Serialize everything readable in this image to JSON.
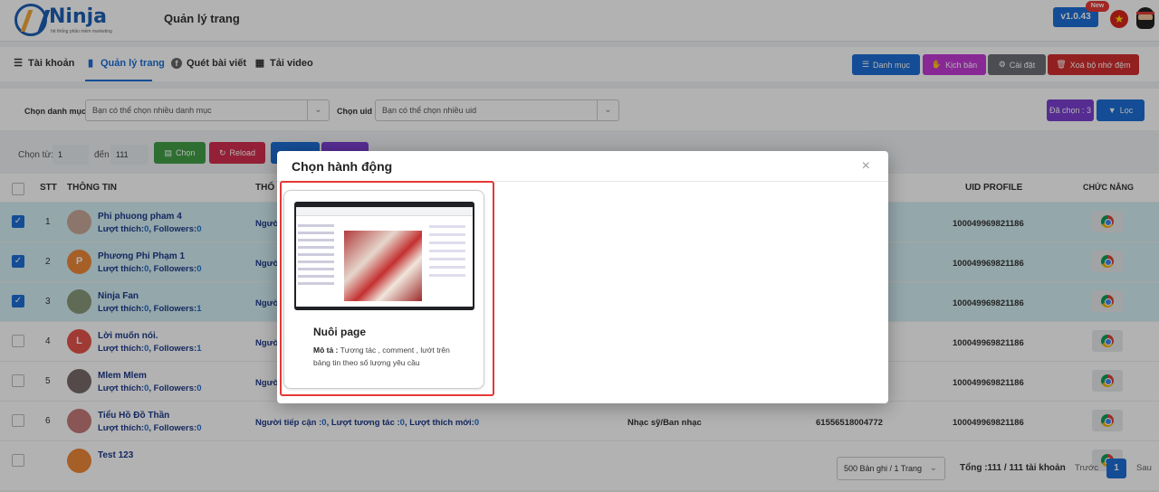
{
  "header": {
    "logo_text": "Ninja",
    "logo_tagline": "hệ thống phần mềm marketing",
    "page_title": "Quản lý trang",
    "version": "v1.0.43",
    "new_badge": "New"
  },
  "tabs": [
    {
      "label": "Tài khoản",
      "icon": "list-icon"
    },
    {
      "label": "Quản lý trang",
      "icon": "page-icon"
    },
    {
      "label": "Quét bài viết",
      "icon": "facebook-icon"
    },
    {
      "label": "Tải video",
      "icon": "video-icon"
    }
  ],
  "toolbar": {
    "category_button": "Danh mục",
    "script_button": "Kịch bản",
    "settings_button": "Cài đặt",
    "clear_cache_button": "Xoá bộ nhớ đệm",
    "colors": {
      "category": "#1d6fd6",
      "script": "#c33ad6",
      "settings": "#6c6f78",
      "clear_cache": "#d32f2f"
    }
  },
  "filters": {
    "category_label": "Chọn danh mục :",
    "category_placeholder": "Bạn có thể chọn nhiều danh mục",
    "uid_label": "Chọn uid :",
    "uid_placeholder": "Bạn có thể chọn nhiều uid",
    "selected_count": "Đã chọn : 3",
    "filter_button": "Lọc"
  },
  "range": {
    "from_label": "Chọn từ:",
    "from_value": "1",
    "to_label": "đến",
    "to_value": "111",
    "select_button": "Chọn",
    "reload_button": "Reload"
  },
  "table": {
    "headers": {
      "stt": "STT",
      "info": "THÔNG TIN",
      "interact": "THỐ",
      "uid_profile": "UID PROFILE",
      "function": "CHỨC NĂNG"
    },
    "rows": [
      {
        "stt": "1",
        "name": "Phi phuong pham 4",
        "likes": "0",
        "followers": "0",
        "avatar_letter": "",
        "avatar_color": "#c9a99a",
        "checked": true,
        "uid": "100049969821186",
        "interact": "Người",
        "reach": "",
        "interactions": "",
        "new_likes": "",
        "category": "",
        "page_id": ""
      },
      {
        "stt": "2",
        "name": "Phương Phi Phạm 1",
        "likes": "0",
        "followers": "0",
        "avatar_letter": "P",
        "avatar_color": "#f0883a",
        "checked": true,
        "uid": "100049969821186",
        "interact": "Người",
        "reach": "",
        "interactions": "",
        "new_likes": "",
        "category": "",
        "page_id": ""
      },
      {
        "stt": "3",
        "name": "Ninja Fan",
        "likes": "0",
        "followers": "1",
        "avatar_letter": "",
        "avatar_color": "#8a9a7a",
        "checked": true,
        "uid": "100049969821186",
        "interact": "Người",
        "reach": "",
        "interactions": "",
        "new_likes": "",
        "category": "",
        "page_id": ""
      },
      {
        "stt": "4",
        "name": "Lời muốn nói.",
        "likes": "0",
        "followers": "1",
        "avatar_letter": "L",
        "avatar_color": "#e5534b",
        "checked": false,
        "uid": "100049969821186",
        "interact": "Người",
        "reach": "",
        "interactions": "",
        "new_likes": "",
        "category": "",
        "page_id": ""
      },
      {
        "stt": "5",
        "name": "Mlem Mlem",
        "likes": "0",
        "followers": "0",
        "avatar_letter": "",
        "avatar_color": "#7a6a6a",
        "checked": false,
        "uid": "100049969821186",
        "interact": "Người",
        "reach": "",
        "interactions": "",
        "new_likes": "",
        "category": "",
        "page_id": ""
      },
      {
        "stt": "6",
        "name": "Tiểu Hồ Đồ Thần",
        "likes": "0",
        "followers": "0",
        "avatar_letter": "",
        "avatar_color": "#c47a7a",
        "checked": false,
        "uid": "100049969821186",
        "interact": "Người tiếp cận :",
        "reach": "0",
        "interactions": "0",
        "new_likes": "0",
        "category": "Nhạc sỹ/Ban nhạc",
        "page_id": "61556518004772"
      },
      {
        "stt": "",
        "name": "Test 123",
        "likes": "",
        "followers": "",
        "avatar_letter": "",
        "avatar_color": "#f0883a",
        "checked": false,
        "uid": "",
        "interact": "",
        "reach": "",
        "interactions": "",
        "new_likes": "",
        "category": "",
        "page_id": ""
      }
    ],
    "labels": {
      "likes": "Lượt thích:",
      "followers": ", Followers:",
      "interactions": ", Lượt tương tác :",
      "new_likes": ", Lượt thích mới:"
    }
  },
  "footer": {
    "per_page": "500 Bản ghi / 1 Trang",
    "total": "Tổng :111 / 111 tài khoản",
    "prev": "Trước",
    "page": "1",
    "next": "Sau"
  },
  "modal": {
    "title": "Chọn hành động",
    "close": "×",
    "card": {
      "title": "Nuôi page",
      "desc_label": "Mô tả :",
      "desc_text": "Tương tác , comment , lướt trên bảng tin theo số lượng yêu cầu"
    }
  }
}
